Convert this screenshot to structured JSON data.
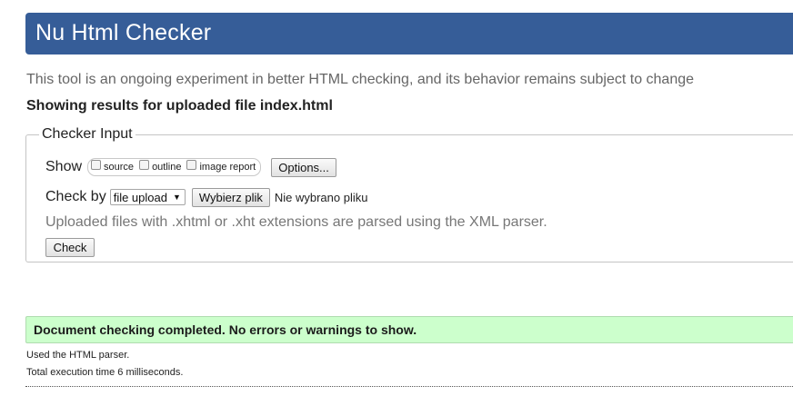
{
  "header": {
    "title": "Nu Html Checker",
    "tagline": "This tool is an ongoing experiment in better HTML checking, and its behavior remains subject to change",
    "results_for": "Showing results for uploaded file index.html"
  },
  "checker_input": {
    "legend": "Checker Input",
    "show_label": "Show",
    "show_options": [
      {
        "label": "source",
        "checked": false
      },
      {
        "label": "outline",
        "checked": false
      },
      {
        "label": "image report",
        "checked": false
      }
    ],
    "options_button": "Options...",
    "check_by_label": "Check by",
    "check_by_selected": "file upload",
    "file_button": "Wybierz plik",
    "file_status": "Nie wybrano pliku",
    "parse_note": "Uploaded files with .xhtml or .xht extensions are parsed using the XML parser.",
    "check_button": "Check"
  },
  "results": {
    "success_message": "Document checking completed. No errors or warnings to show.",
    "parser_info": "Used the HTML parser.",
    "time_info": "Total execution time 6 milliseconds."
  },
  "colors": {
    "title_bar": "#365d98",
    "success_bg": "#ccffcc",
    "muted_text": "#777777"
  }
}
